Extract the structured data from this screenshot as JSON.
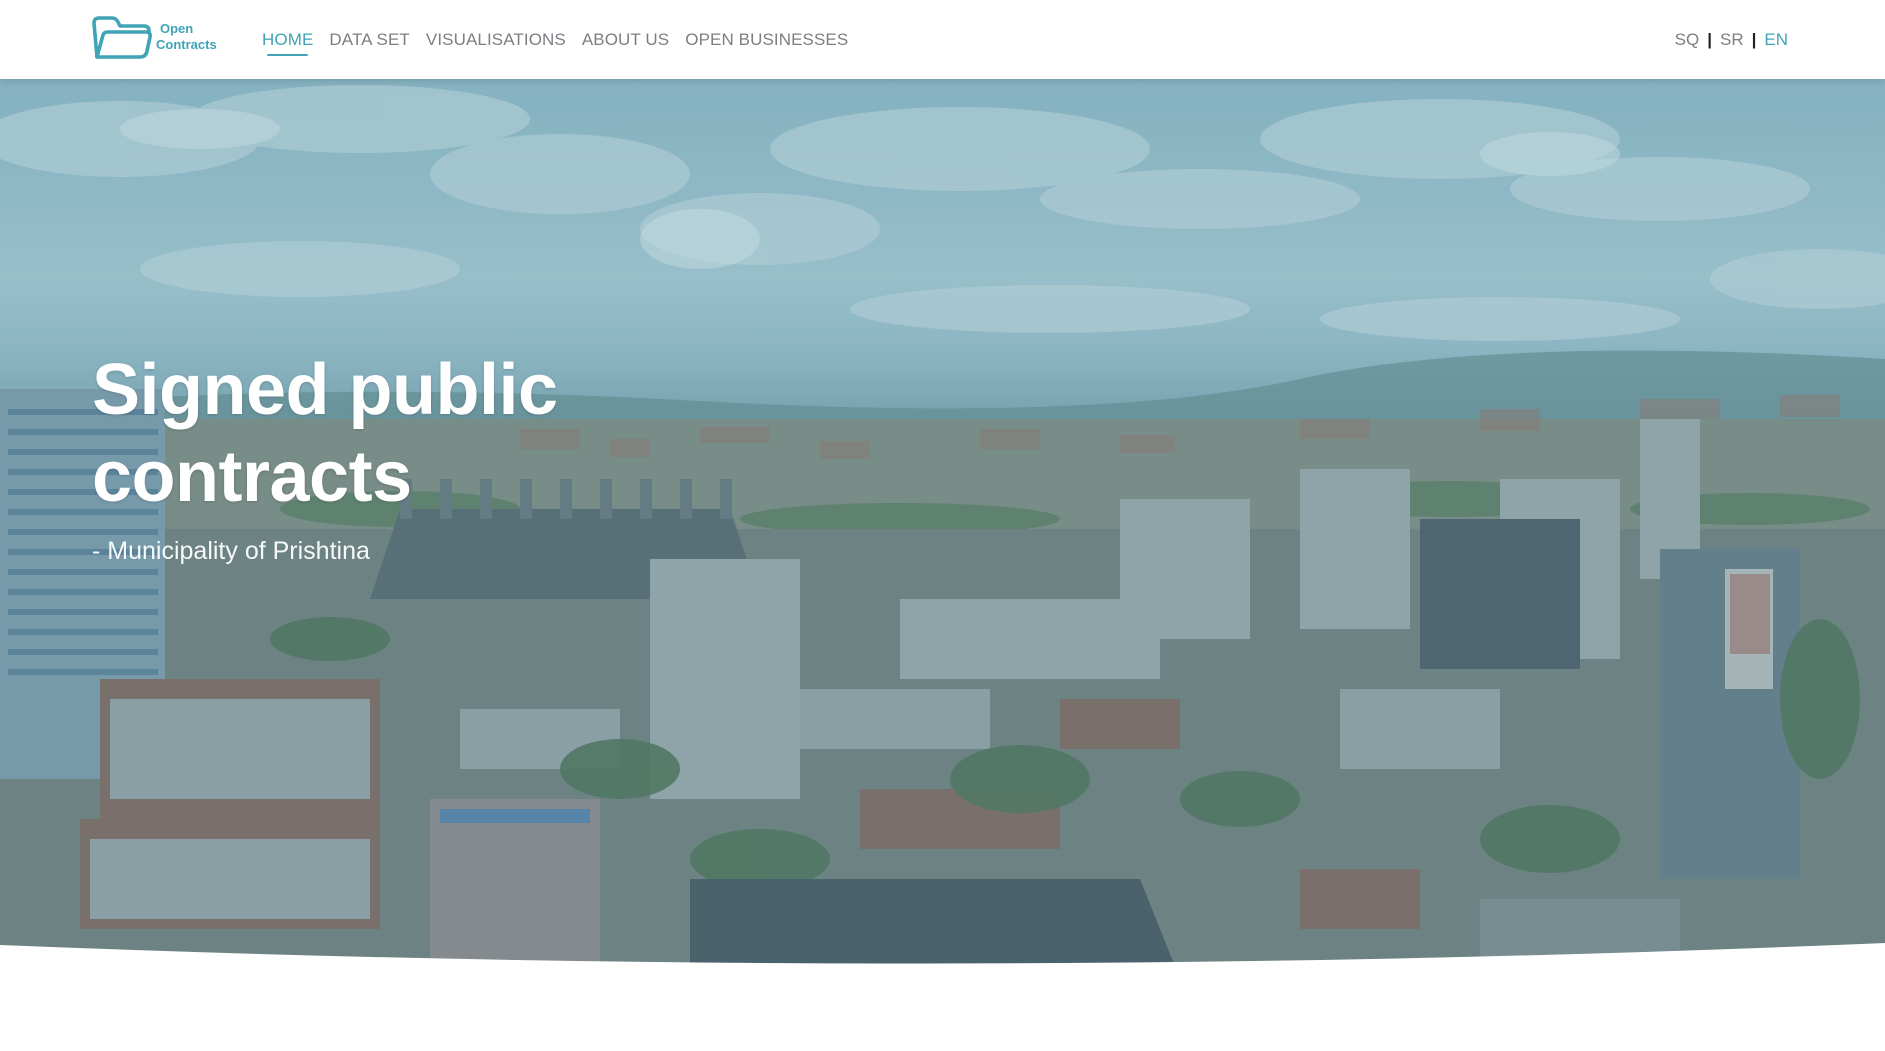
{
  "header": {
    "logo": {
      "line1": "Open",
      "line2": "Contracts"
    },
    "nav": [
      {
        "label": "HOME",
        "active": true
      },
      {
        "label": "DATA SET",
        "active": false
      },
      {
        "label": "VISUALISATIONS",
        "active": false
      },
      {
        "label": "ABOUT US",
        "active": false
      },
      {
        "label": "OPEN BUSINESSES",
        "active": false
      }
    ],
    "languages": [
      {
        "label": "SQ",
        "active": false
      },
      {
        "label": "SR",
        "active": false
      },
      {
        "label": "EN",
        "active": true
      }
    ],
    "separator": "|"
  },
  "hero": {
    "title": "Signed public contracts",
    "subtitle": "- Municipality of Prishtina"
  },
  "colors": {
    "accent": "#3fa4b6",
    "nav_text": "#7b7f83",
    "hero_text": "#ffffff"
  },
  "icons": {
    "logo": "folder-icon"
  }
}
